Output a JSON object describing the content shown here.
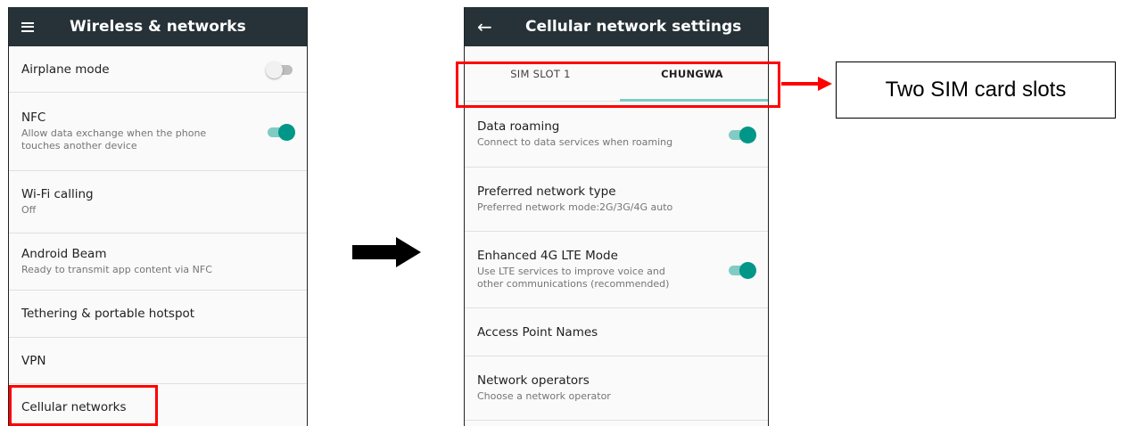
{
  "left_screen": {
    "appbar": {
      "title": "Wireless & networks",
      "menu_icon": "hamburger-menu-icon"
    },
    "items": [
      {
        "label": "Airplane mode",
        "toggle": false
      },
      {
        "label": "NFC",
        "sub": "Allow data exchange when the phone touches another device",
        "toggle": true
      },
      {
        "label": "Wi-Fi calling",
        "sub": "Off"
      },
      {
        "label": "Android Beam",
        "sub": "Ready to transmit app content via NFC"
      },
      {
        "label": "Tethering & portable hotspot"
      },
      {
        "label": "VPN"
      },
      {
        "label": "Cellular networks"
      }
    ]
  },
  "right_screen": {
    "appbar": {
      "title": "Cellular network settings",
      "back_icon": "back-arrow-icon"
    },
    "tabs": [
      {
        "label": "SIM SLOT 1",
        "active": false
      },
      {
        "label": "CHUNGWA",
        "active": true
      }
    ],
    "items": [
      {
        "label": "Data roaming",
        "sub": "Connect to data services when roaming",
        "toggle": true
      },
      {
        "label": "Preferred network type",
        "sub": "Preferred network mode:2G/3G/4G auto"
      },
      {
        "label": "Enhanced 4G LTE Mode",
        "sub": "Use LTE services to improve voice and other communications (recommended)",
        "toggle": true
      },
      {
        "label": "Access Point Names"
      },
      {
        "label": "Network operators",
        "sub": "Choose a network operator"
      }
    ]
  },
  "annotation": {
    "callout_text": "Two SIM card slots"
  },
  "colors": {
    "appbar": "#263238",
    "accent": "#009688",
    "highlight": "#ff0000"
  }
}
